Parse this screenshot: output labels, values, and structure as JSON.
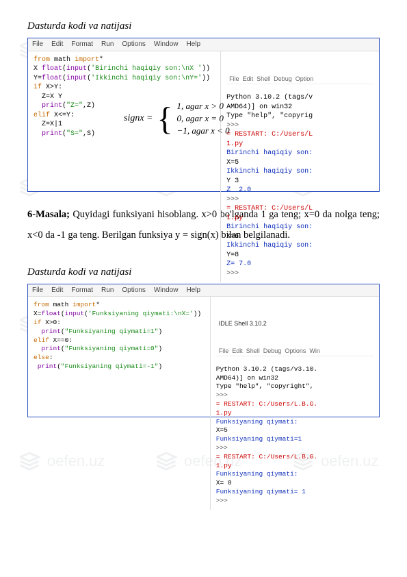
{
  "watermark_text": "oefen.uz",
  "section1_title": "Dasturda kodi va natijasi",
  "shot1": {
    "menu": [
      "File",
      "Edit",
      "Format",
      "Run",
      "Options",
      "Window",
      "Help"
    ],
    "shell_menu": "File  Edit  Shell  Debug  Option",
    "code": {
      "l1a": "from",
      "l1b": " math ",
      "l1c": "import",
      "l1d": "*",
      "l2a": "X ",
      "l2b": "float",
      "l2c": "(",
      "l2d": "input",
      "l2e": "(",
      "l2f": "'Birinchi haqiqiy son:\\nX '",
      "l2g": "))",
      "l3a": "Y=",
      "l3b": "float",
      "l3c": "(",
      "l3d": "input",
      "l3e": "(",
      "l3f": "'Ikkinchi haqiqiy son:\\nY='",
      "l3g": "))",
      "l4a": "if",
      "l4b": " X>Y:",
      "l5": "  Z=X Y",
      "l6a": "  print",
      "l6b": "(",
      "l6c": "\"Z=\"",
      "l6d": ",Z)",
      "l7a": "elif",
      "l7b": " X<=Y:",
      "l8": "  Z=X|1",
      "l9a": "  print",
      "l9b": "(",
      "l9c": "\"S=\"",
      "l9d": ",S)"
    },
    "shell": {
      "s1": "Python 3.10.2 (tags/v",
      "s2": "AMD64)] on win32",
      "s3": "Type \"help\", \"copyrig",
      "p1": ">>>",
      "s4": "= RESTART: C:/Users/L",
      "s5": "1.py",
      "s6": "Birinchi haqiqiy son:",
      "s7": "X=5",
      "s8": "Ikkinchi haqiqiy son:",
      "s9": "Y 3",
      "s10": "Z  2.0",
      "p2": ">>>",
      "s11": "= RESTART: C:/Users/L",
      "s12": "1.py",
      "s13": "Birinchi haqiqiy son:",
      "s14": "X=6",
      "s15": "Ikkinchi haqiqiy son:",
      "s16": "Y=8",
      "s17": "Z= 7.0",
      "p3": ">>>"
    }
  },
  "formula": {
    "lhs": "signx =",
    "c1": "1, agar   x > 0",
    "c2": "0, agar   x = 0",
    "c3": "−1, agar  x < 0"
  },
  "prose": {
    "lead": "6-Masala;",
    "body": " Quyidagi funksiyani hisoblang. x>0 bo'lganda 1 ga teng; x=0 da nolga teng; x<0 da -1 ga teng. Berilgan funksiya y = sign(x) bilan belgilanadi."
  },
  "section2_title": "Dasturda kodi va natijasi",
  "shot2": {
    "menu": [
      "File",
      "Edit",
      "Format",
      "Run",
      "Options",
      "Window",
      "Help"
    ],
    "shell_title": "IDLE Shell 3.10.2",
    "shell_menu": "File  Edit  Shell  Debug  Options  Win",
    "code": {
      "l1a": "from",
      "l1b": " math ",
      "l1c": "import",
      "l1d": "*",
      "l2a": "X=",
      "l2b": "float",
      "l2c": "(",
      "l2d": "input",
      "l2e": "(",
      "l2f": "'Funksiyaning qiymati:\\nX='",
      "l2g": "))",
      "l3a": "if",
      "l3b": " X>0:",
      "l4a": "  print",
      "l4b": "(",
      "l4c": "\"Funksiyaning qiymati=1\"",
      "l4d": ")",
      "l5a": "elif",
      "l5b": " X==0:",
      "l6a": "  print",
      "l6b": "(",
      "l6c": "\"Funksiyaning qiymati=0\"",
      "l6d": ")",
      "l7a": "else",
      "l7b": ":",
      "l8a": " print",
      "l8b": "(",
      "l8c": "\"Funksiyaning qiymati=-1\"",
      "l8d": ")"
    },
    "shell": {
      "s1": "Python 3.10.2 (tags/v3.10.",
      "s2": "AMD64)] on win32",
      "s3": "Type \"help\", \"copyright\",",
      "p1": ">>>",
      "s4": "= RESTART: C:/Users/L.B.G.",
      "s5": "1.py",
      "s6": "Funksiyaning qiymati:",
      "s7": "X=5",
      "s8": "Funksiyaning qiymati=1",
      "p2": ">>>",
      "s9": "= RESTART: C:/Users/L.B.G.",
      "s10": "1.py",
      "s11": "Funksiyaning qiymati:",
      "s12": "X= 8",
      "s13": "Funksiyaning qiymati= 1",
      "p3": ">>>"
    }
  }
}
